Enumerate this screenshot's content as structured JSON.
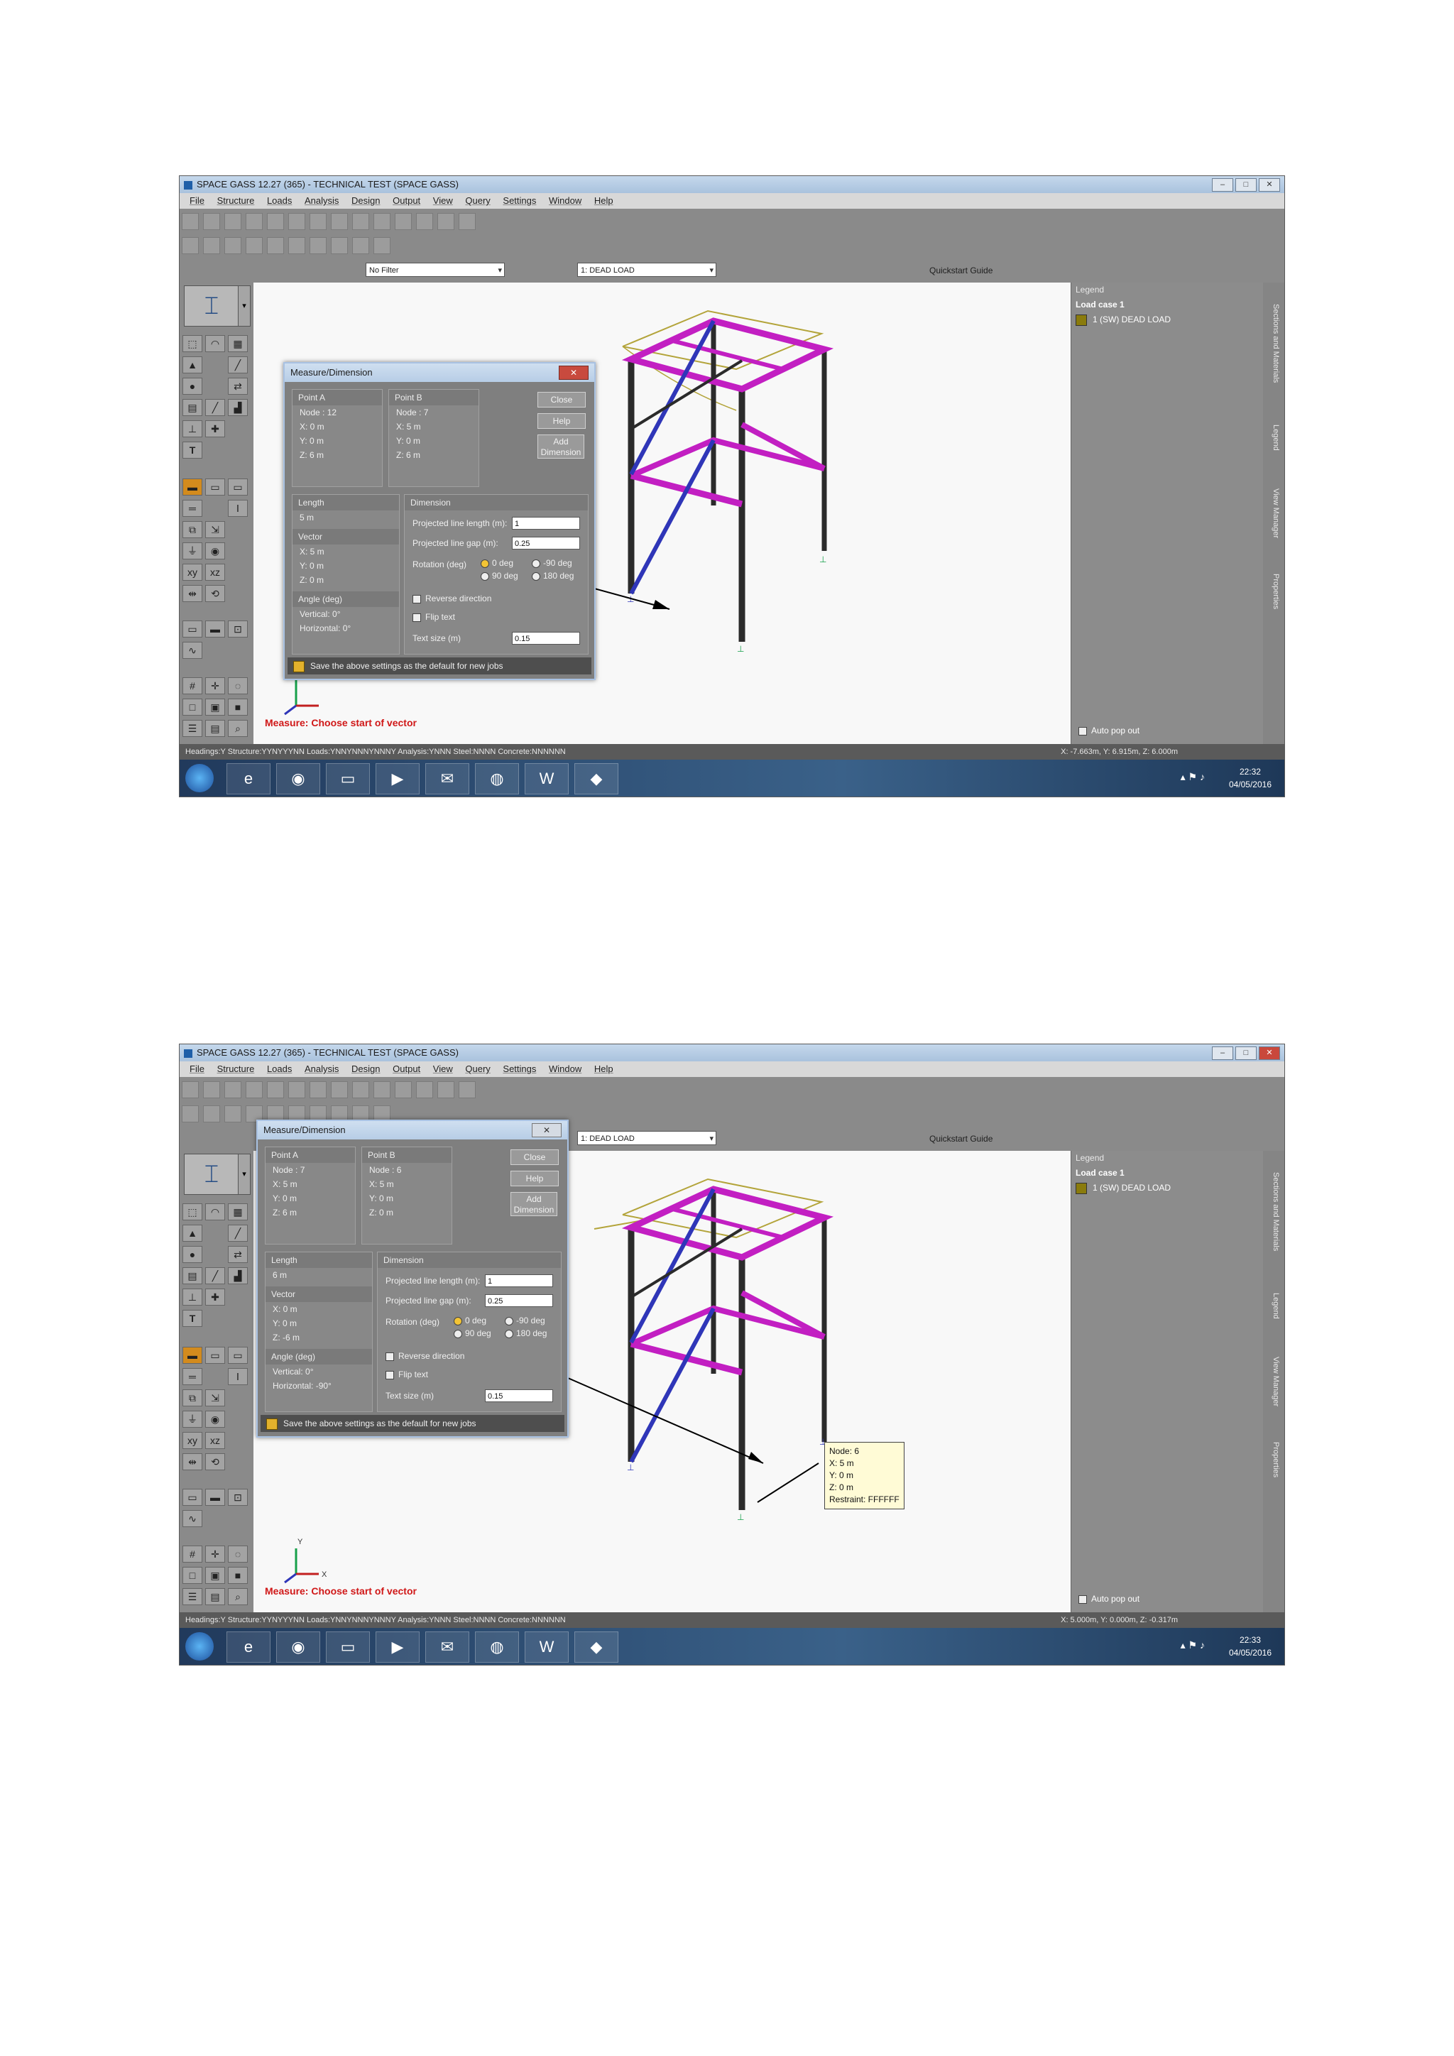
{
  "window": {
    "app_title": "SPACE GASS 12.27 (365) - TECHNICAL TEST (SPACE GASS)"
  },
  "menu": [
    "File",
    "Structure",
    "Loads",
    "Analysis",
    "Design",
    "Output",
    "View",
    "Query",
    "Settings",
    "Window",
    "Help"
  ],
  "toolbar": {
    "filter_value": "No Filter",
    "loadcase_value": "1: DEAD LOAD",
    "quickstart_label": "Quickstart Guide"
  },
  "legend": {
    "header": "Legend",
    "load_case": "Load case 1",
    "entry": "1 (SW)    DEAD LOAD",
    "auto_pop": "Auto pop out"
  },
  "side_tabs": [
    "Sections and Materials",
    "Legend",
    "View Manager",
    "Properties"
  ],
  "dialog": {
    "title": "Measure/Dimension",
    "point_a": "Point A",
    "point_b": "Point B",
    "close": "Close",
    "help": "Help",
    "add_dimension": "Add Dimension",
    "length": "Length",
    "vector": "Vector",
    "angle": "Angle (deg)",
    "dimension": "Dimension",
    "proj_len_label": "Projected line length (m):",
    "proj_gap_label": "Projected line gap (m):",
    "rotation_label": "Rotation (deg)",
    "rot_0": "0 deg",
    "rot_m90": "-90 deg",
    "rot_90": "90 deg",
    "rot_180": "180 deg",
    "reverse": "Reverse direction",
    "flip": "Flip text",
    "text_size_label": "Text size (m)",
    "proj_len_value": "1",
    "proj_gap_value": "0.25",
    "text_size_value": "0.15",
    "save": "Save the above settings as the default for new jobs"
  },
  "shot1": {
    "a_node": "Node : 12",
    "a_x": "X: 0 m",
    "a_y": "Y: 0 m",
    "a_z": "Z: 6 m",
    "b_node": "Node : 7",
    "b_x": "X: 5 m",
    "b_y": "Y: 0 m",
    "b_z": "Z: 6 m",
    "length_value": "5 m",
    "vec_x": "X: 5 m",
    "vec_y": "Y: 0 m",
    "vec_z": "Z: 0 m",
    "ang_v": "Vertical:    0°",
    "ang_h": "Horizontal:  0°",
    "status_left": "Headings:Y Structure:YYNYYYNN Loads:YNNYNNNYNNNY Analysis:YNNN Steel:NNNN Concrete:NNNNNN",
    "status_right": "X: -7.663m, Y: 6.915m, Z: 6.000m",
    "time": "22:32",
    "date": "04/05/2016",
    "message": "Measure: Choose start of vector"
  },
  "shot2": {
    "a_node": "Node : 7",
    "a_x": "X: 5 m",
    "a_y": "Y: 0 m",
    "a_z": "Z: 6 m",
    "b_node": "Node : 6",
    "b_x": "X: 5 m",
    "b_y": "Y: 0 m",
    "b_z": "Z: 0 m",
    "length_value": "6 m",
    "vec_x": "X: 0 m",
    "vec_y": "Y: 0 m",
    "vec_z": "Z: -6 m",
    "ang_v": "Vertical:    0°",
    "ang_h": "Horizontal:  -90°",
    "status_left": "Headings:Y Structure:YYNYYYNN Loads:YNNYNNNYNNNY Analysis:YNNN Steel:NNNN Concrete:NNNNNN",
    "status_right": "X: 5.000m, Y: 0.000m, Z: -0.317m",
    "time": "22:33",
    "date": "04/05/2016",
    "message": "Measure: Choose start of vector",
    "tooltip": {
      "node": "Node: 6",
      "x": "X: 5 m",
      "y": "Y: 0 m",
      "z": "Z: 0 m",
      "restraint": "Restraint: FFFFFF"
    }
  },
  "axes": {
    "y": "Y",
    "x": "X"
  },
  "colors": {
    "member_dark": "#2b2b2b",
    "member_magenta": "#c21fc2",
    "member_blue": "#2f36b8",
    "load_line": "#b3a43a"
  }
}
